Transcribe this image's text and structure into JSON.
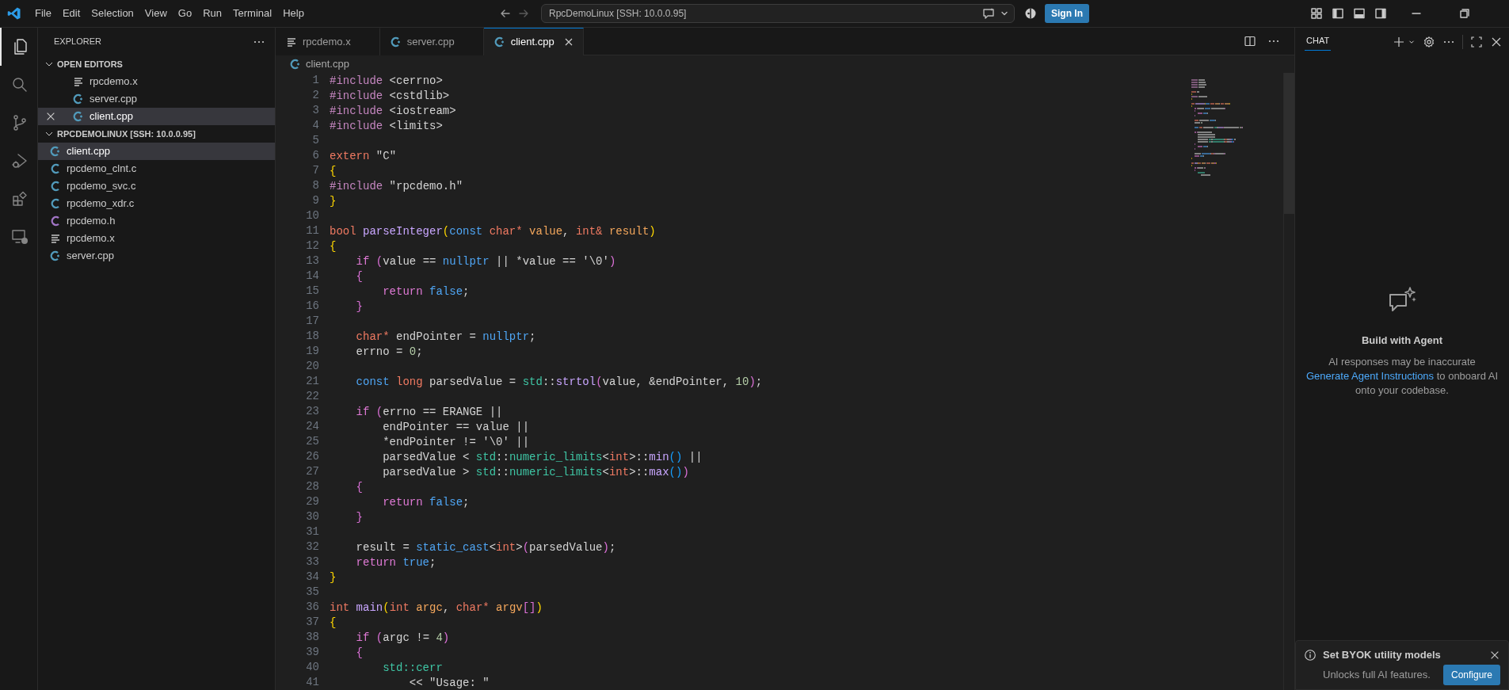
{
  "title_bar": {
    "menus": [
      "File",
      "Edit",
      "Selection",
      "View",
      "Go",
      "Run",
      "Terminal",
      "Help"
    ],
    "command_center": "RpcDemoLinux [SSH: 10.0.0.95]",
    "sign_in": "Sign In"
  },
  "activity_bar": [
    {
      "kind": "explorer",
      "selected": true
    },
    {
      "kind": "search",
      "selected": false
    },
    {
      "kind": "scm",
      "selected": false
    },
    {
      "kind": "debug",
      "selected": false
    },
    {
      "kind": "extensions",
      "selected": false
    },
    {
      "kind": "remote",
      "selected": false
    }
  ],
  "explorer": {
    "title": "EXPLORER",
    "sections": [
      {
        "kind": "open_editors",
        "title": "OPEN EDITORS",
        "expanded": true,
        "items": [
          {
            "name": "rpcdemo.x",
            "kind": "x",
            "selected": false
          },
          {
            "name": "server.cpp",
            "kind": "cpp",
            "selected": false
          },
          {
            "name": "client.cpp",
            "kind": "cpp",
            "selected": true
          }
        ]
      },
      {
        "kind": "folder",
        "title": "RPCDEMOLINUX [SSH: 10.0.0.95]",
        "expanded": true,
        "items": [
          {
            "name": "client.cpp",
            "kind": "cpp",
            "selected": true
          },
          {
            "name": "rpcdemo_clnt.c",
            "kind": "c",
            "selected": false
          },
          {
            "name": "rpcdemo_svc.c",
            "kind": "c",
            "selected": false
          },
          {
            "name": "rpcdemo_xdr.c",
            "kind": "c",
            "selected": false
          },
          {
            "name": "rpcdemo.h",
            "kind": "h",
            "selected": false
          },
          {
            "name": "rpcdemo.x",
            "kind": "x",
            "selected": false
          },
          {
            "name": "server.cpp",
            "kind": "cpp",
            "selected": false
          }
        ]
      }
    ]
  },
  "tabs": [
    {
      "label": "rpcdemo.x",
      "kind": "x",
      "selected": false
    },
    {
      "label": "server.cpp",
      "kind": "cpp",
      "selected": false
    },
    {
      "label": "client.cpp",
      "kind": "cpp",
      "selected": true
    }
  ],
  "breadcrumb": {
    "label": "client.cpp",
    "kind": "cpp"
  },
  "code": {
    "lines": [
      {
        "number": "1",
        "tokens": [
          {
            "text": "#include",
            "kind": "pp"
          },
          {
            "text": " <cerrno>",
            "kind": "plain"
          }
        ]
      },
      {
        "number": "2",
        "tokens": [
          {
            "text": "#include",
            "kind": "pp"
          },
          {
            "text": " <cstdlib>",
            "kind": "plain"
          }
        ]
      },
      {
        "number": "3",
        "tokens": [
          {
            "text": "#include",
            "kind": "pp"
          },
          {
            "text": " <iostream>",
            "kind": "plain"
          }
        ]
      },
      {
        "number": "4",
        "tokens": [
          {
            "text": "#include",
            "kind": "pp"
          },
          {
            "text": " <limits>",
            "kind": "plain"
          }
        ]
      },
      {
        "number": "5"
      },
      {
        "number": "6",
        "tokens": [
          {
            "text": "extern",
            "kind": "type"
          },
          {
            "text": " \"C\"",
            "kind": "plain"
          }
        ]
      },
      {
        "number": "7",
        "tokens": [
          {
            "text": "{",
            "kind": "b1"
          }
        ]
      },
      {
        "number": "8",
        "tokens": [
          {
            "text": "#include",
            "kind": "pp"
          },
          {
            "text": " \"rpcdemo.h\"",
            "kind": "plain"
          }
        ]
      },
      {
        "number": "9",
        "tokens": [
          {
            "text": "}",
            "kind": "b1"
          }
        ]
      },
      {
        "number": "10"
      },
      {
        "number": "11",
        "tokens": [
          {
            "text": "bool",
            "kind": "type"
          },
          {
            "text": " parseInteger",
            "kind": "fn"
          },
          {
            "text": "(",
            "kind": "b1"
          },
          {
            "text": "const",
            "kind": "const"
          },
          {
            "text": " char*",
            "kind": "type"
          },
          {
            "text": " value",
            "kind": "param"
          },
          {
            "text": ", ",
            "kind": "plain"
          },
          {
            "text": "int&",
            "kind": "type"
          },
          {
            "text": " result",
            "kind": "param"
          },
          {
            "text": ")",
            "kind": "b1"
          }
        ]
      },
      {
        "number": "12",
        "tokens": [
          {
            "text": "{",
            "kind": "b1"
          }
        ]
      },
      {
        "number": "13",
        "tokens": [
          {
            "text": "    if",
            "kind": "ctl"
          },
          {
            "text": " (",
            "kind": "b2"
          },
          {
            "text": "value == ",
            "kind": "plain"
          },
          {
            "text": "nullptr",
            "kind": "const"
          },
          {
            "text": " || *value == '\\0'",
            "kind": "plain"
          },
          {
            "text": ")",
            "kind": "b2"
          }
        ]
      },
      {
        "number": "14",
        "tokens": [
          {
            "text": "    {",
            "kind": "b2"
          }
        ]
      },
      {
        "number": "15",
        "tokens": [
          {
            "text": "        return",
            "kind": "ctl"
          },
          {
            "text": " false",
            "kind": "const"
          },
          {
            "text": ";",
            "kind": "plain"
          }
        ]
      },
      {
        "number": "16",
        "tokens": [
          {
            "text": "    }",
            "kind": "b2"
          }
        ]
      },
      {
        "number": "17"
      },
      {
        "number": "18",
        "tokens": [
          {
            "text": "    char*",
            "kind": "type"
          },
          {
            "text": " endPointer = ",
            "kind": "plain"
          },
          {
            "text": "nullptr",
            "kind": "const"
          },
          {
            "text": ";",
            "kind": "plain"
          }
        ]
      },
      {
        "number": "19",
        "tokens": [
          {
            "text": "    errno = ",
            "kind": "plain"
          },
          {
            "text": "0",
            "kind": "num"
          },
          {
            "text": ";",
            "kind": "plain"
          }
        ]
      },
      {
        "number": "20"
      },
      {
        "number": "21",
        "tokens": [
          {
            "text": "    const",
            "kind": "const"
          },
          {
            "text": " long",
            "kind": "type"
          },
          {
            "text": " parsedValue = ",
            "kind": "plain"
          },
          {
            "text": "std",
            "kind": "ns"
          },
          {
            "text": "::",
            "kind": "plain"
          },
          {
            "text": "strtol",
            "kind": "fn"
          },
          {
            "text": "(",
            "kind": "b2"
          },
          {
            "text": "value, &endPointer, ",
            "kind": "plain"
          },
          {
            "text": "10",
            "kind": "num"
          },
          {
            "text": ")",
            "kind": "b2"
          },
          {
            "text": ";",
            "kind": "plain"
          }
        ]
      },
      {
        "number": "22"
      },
      {
        "number": "23",
        "tokens": [
          {
            "text": "    if",
            "kind": "ctl"
          },
          {
            "text": " (",
            "kind": "b2"
          },
          {
            "text": "errno == ERANGE ||",
            "kind": "plain"
          }
        ]
      },
      {
        "number": "24",
        "tokens": [
          {
            "text": "        endPointer == value ||",
            "kind": "plain"
          }
        ]
      },
      {
        "number": "25",
        "tokens": [
          {
            "text": "        *endPointer != '\\0' ||",
            "kind": "plain"
          }
        ]
      },
      {
        "number": "26",
        "tokens": [
          {
            "text": "        parsedValue < ",
            "kind": "plain"
          },
          {
            "text": "std",
            "kind": "ns"
          },
          {
            "text": "::",
            "kind": "plain"
          },
          {
            "text": "numeric_limits",
            "kind": "ns"
          },
          {
            "text": "<",
            "kind": "plain"
          },
          {
            "text": "int",
            "kind": "type"
          },
          {
            "text": ">::",
            "kind": "plain"
          },
          {
            "text": "min",
            "kind": "fn"
          },
          {
            "text": "()",
            "kind": "b3"
          },
          {
            "text": " ||",
            "kind": "plain"
          }
        ]
      },
      {
        "number": "27",
        "tokens": [
          {
            "text": "        parsedValue > ",
            "kind": "plain"
          },
          {
            "text": "std",
            "kind": "ns"
          },
          {
            "text": "::",
            "kind": "plain"
          },
          {
            "text": "numeric_limits",
            "kind": "ns"
          },
          {
            "text": "<",
            "kind": "plain"
          },
          {
            "text": "int",
            "kind": "type"
          },
          {
            "text": ">::",
            "kind": "plain"
          },
          {
            "text": "max",
            "kind": "fn"
          },
          {
            "text": "()",
            "kind": "b3"
          },
          {
            "text": ")",
            "kind": "b2"
          }
        ]
      },
      {
        "number": "28",
        "tokens": [
          {
            "text": "    {",
            "kind": "b2"
          }
        ]
      },
      {
        "number": "29",
        "tokens": [
          {
            "text": "        return",
            "kind": "ctl"
          },
          {
            "text": " false",
            "kind": "const"
          },
          {
            "text": ";",
            "kind": "plain"
          }
        ]
      },
      {
        "number": "30",
        "tokens": [
          {
            "text": "    }",
            "kind": "b2"
          }
        ]
      },
      {
        "number": "31"
      },
      {
        "number": "32",
        "tokens": [
          {
            "text": "    result = ",
            "kind": "plain"
          },
          {
            "text": "static_cast",
            "kind": "const"
          },
          {
            "text": "<",
            "kind": "plain"
          },
          {
            "text": "int",
            "kind": "type"
          },
          {
            "text": ">",
            "kind": "plain"
          },
          {
            "text": "(",
            "kind": "b2"
          },
          {
            "text": "parsedValue",
            "kind": "plain"
          },
          {
            "text": ")",
            "kind": "b2"
          },
          {
            "text": ";",
            "kind": "plain"
          }
        ]
      },
      {
        "number": "33",
        "tokens": [
          {
            "text": "    return",
            "kind": "ctl"
          },
          {
            "text": " true",
            "kind": "const"
          },
          {
            "text": ";",
            "kind": "plain"
          }
        ]
      },
      {
        "number": "34",
        "tokens": [
          {
            "text": "}",
            "kind": "b1"
          }
        ]
      },
      {
        "number": "35"
      },
      {
        "number": "36",
        "tokens": [
          {
            "text": "int",
            "kind": "type"
          },
          {
            "text": " main",
            "kind": "fn"
          },
          {
            "text": "(",
            "kind": "b1"
          },
          {
            "text": "int",
            "kind": "type"
          },
          {
            "text": " argc",
            "kind": "param"
          },
          {
            "text": ", ",
            "kind": "plain"
          },
          {
            "text": "char*",
            "kind": "type"
          },
          {
            "text": " argv",
            "kind": "param"
          },
          {
            "text": "[]",
            "kind": "b2"
          },
          {
            "text": ")",
            "kind": "b1"
          }
        ]
      },
      {
        "number": "37",
        "tokens": [
          {
            "text": "{",
            "kind": "b1"
          }
        ]
      },
      {
        "number": "38",
        "tokens": [
          {
            "text": "    if",
            "kind": "ctl"
          },
          {
            "text": " (",
            "kind": "b2"
          },
          {
            "text": "argc != ",
            "kind": "plain"
          },
          {
            "text": "4",
            "kind": "num"
          },
          {
            "text": ")",
            "kind": "b2"
          }
        ]
      },
      {
        "number": "39",
        "tokens": [
          {
            "text": "    {",
            "kind": "b2"
          }
        ]
      },
      {
        "number": "40",
        "tokens": [
          {
            "text": "        std::cerr",
            "kind": "ns"
          }
        ]
      },
      {
        "number": "41",
        "tokens": [
          {
            "text": "            << \"Usage: \"",
            "kind": "plain"
          }
        ]
      }
    ]
  },
  "chat": {
    "tab": "CHAT",
    "heading": "Build with Agent",
    "note": "AI responses may be inaccurate",
    "link": "Generate Agent Instructions",
    "link_rest": " to onboard AI onto your codebase."
  },
  "notification": {
    "title": "Set BYOK utility models",
    "message": "Unlocks full AI features.",
    "button": "Configure"
  }
}
